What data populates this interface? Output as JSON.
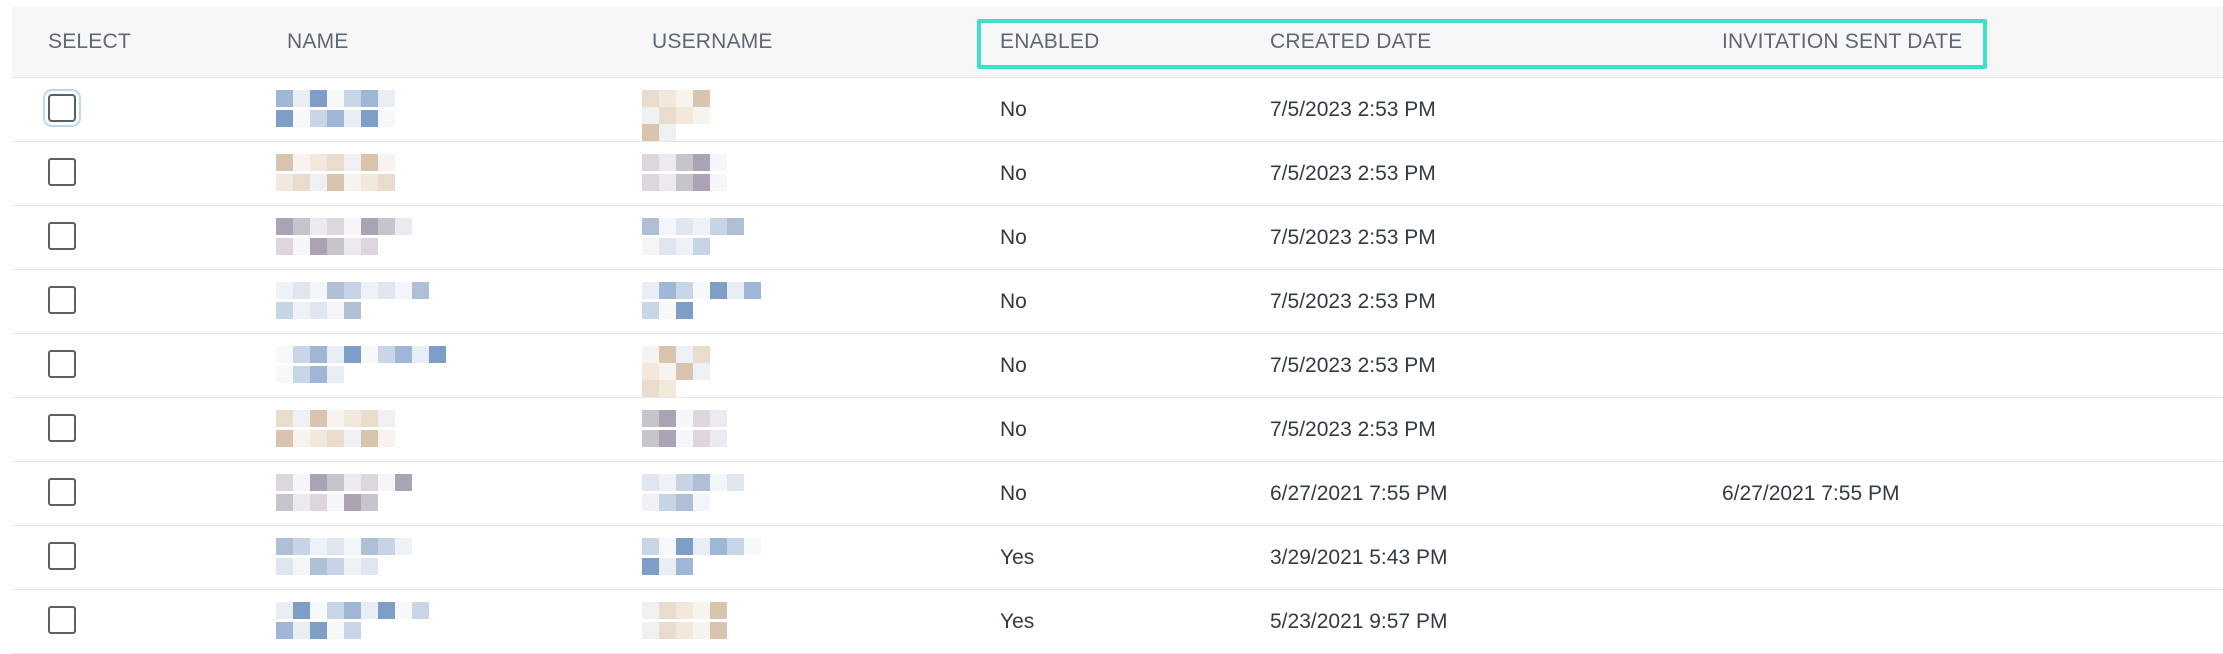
{
  "table": {
    "columns": {
      "select": "SELECT",
      "name": "NAME",
      "username": "USERNAME",
      "enabled": "ENABLED",
      "created_date": "CREATED DATE",
      "invitation_sent_date": "INVITATION SENT DATE"
    },
    "highlight_color": "#3ee0c8",
    "rows": [
      {
        "enabled": "No",
        "created": "7/5/2023 2:53 PM",
        "invitation": "",
        "checked": false
      },
      {
        "enabled": "No",
        "created": "7/5/2023 2:53 PM",
        "invitation": "",
        "checked": false
      },
      {
        "enabled": "No",
        "created": "7/5/2023 2:53 PM",
        "invitation": "",
        "checked": false
      },
      {
        "enabled": "No",
        "created": "7/5/2023 2:53 PM",
        "invitation": "",
        "checked": false
      },
      {
        "enabled": "No",
        "created": "7/5/2023 2:53 PM",
        "invitation": "",
        "checked": false
      },
      {
        "enabled": "No",
        "created": "7/5/2023 2:53 PM",
        "invitation": "",
        "checked": false
      },
      {
        "enabled": "No",
        "created": "6/27/2021 7:55 PM",
        "invitation": "6/27/2021 7:55 PM",
        "checked": false
      },
      {
        "enabled": "Yes",
        "created": "3/29/2021 5:43 PM",
        "invitation": "",
        "checked": false
      },
      {
        "enabled": "Yes",
        "created": "5/23/2021 9:57 PM",
        "invitation": "",
        "checked": false
      }
    ]
  }
}
